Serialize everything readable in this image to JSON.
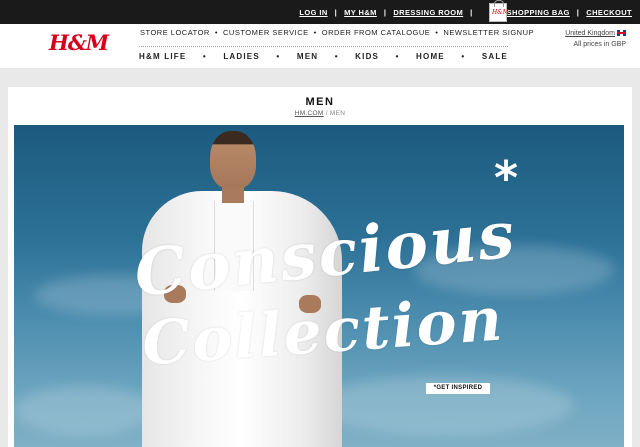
{
  "topbar": {
    "links": [
      "LOG IN",
      "MY H&M",
      "DRESSING ROOM"
    ],
    "shopping_bag": "SHOPPING BAG",
    "checkout": "CHECKOUT",
    "bag_icon_text": "H&M"
  },
  "header": {
    "logo": "H&M",
    "subnav": [
      "STORE LOCATOR",
      "CUSTOMER SERVICE",
      "ORDER FROM CATALOGUE",
      "NEWSLETTER SIGNUP"
    ],
    "mainnav": [
      "H&M LIFE",
      "LADIES",
      "MEN",
      "KIDS",
      "HOME",
      "SALE"
    ],
    "region": {
      "country": "United Kingdom",
      "currency_note": "All prices in GBP"
    }
  },
  "page": {
    "title": "MEN",
    "breadcrumb": {
      "home": "HM.COM",
      "separator": " / ",
      "current": "MEN"
    }
  },
  "hero": {
    "headline_line1": "Conscious",
    "headline_line2": "Collection",
    "asterisk": "*",
    "cta": "*GET INSPIRED"
  },
  "colors": {
    "brand_red": "#d6001c",
    "topbar_bg": "#1a1a1a",
    "sky_top": "#1c5a7e",
    "sky_bottom": "#7fb0c6"
  }
}
